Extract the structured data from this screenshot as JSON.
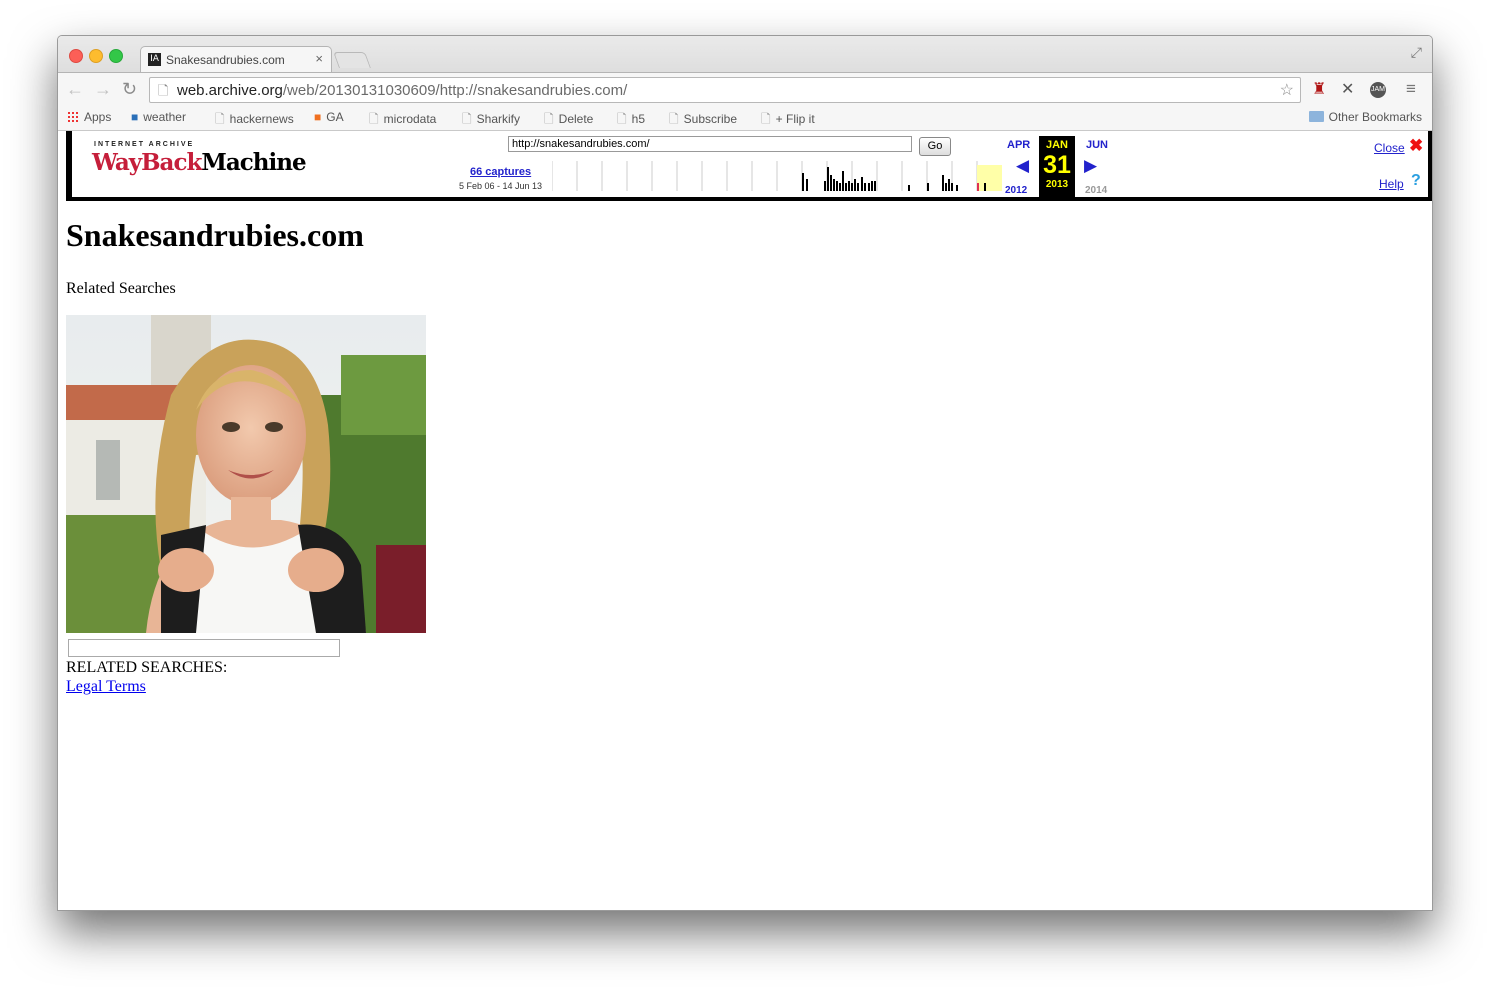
{
  "browser": {
    "tab_title": "Snakesandrubies.com",
    "tab_close": "×",
    "tab_favicon": "IA",
    "url_host": "web.archive.org",
    "url_path": "/web/20130131030609/http://snakesandrubies.com/",
    "back_icon": "←",
    "forward_icon": "→",
    "reload_icon": "↻",
    "fullscreen_icon": "⤢",
    "menu_icon": "≡",
    "ext3_label": "JAM"
  },
  "bookmarks": {
    "items": [
      "Apps",
      "weather",
      "hackernews",
      "GA",
      "microdata",
      "Sharkify",
      "Delete",
      "h5",
      "Subscribe",
      "+ Flip it"
    ],
    "other": "Other Bookmarks"
  },
  "wayback": {
    "logo_top": "INTERNET ARCHIVE",
    "logo_a": "WayBack",
    "logo_b": "Machine",
    "url_value": "http://snakesandrubies.com/",
    "go_label": "Go",
    "captures": "66 captures",
    "range": "5 Feb 06 - 14 Jun 13",
    "prev_month": "APR",
    "cur_month": "JAN",
    "next_month": "JUN",
    "cur_day": "31",
    "prev_year": "2012",
    "cur_year": "2013",
    "next_year": "2014",
    "close": "Close",
    "close_x": "✖",
    "help": "Help",
    "help_q": "?",
    "prev_arrow": "◀",
    "next_arrow": "▶"
  },
  "page": {
    "title": "Snakesandrubies.com",
    "related_searches": "Related Searches",
    "related_caps": "RELATED SEARCHES:",
    "legal_terms": "Legal Terms"
  }
}
